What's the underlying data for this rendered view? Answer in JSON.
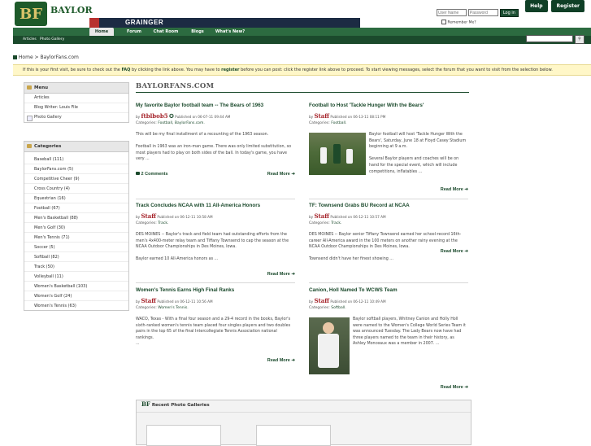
{
  "header": {
    "logo_letters": "BF",
    "logo_text": "BAYLOR",
    "banner_text": "GRAINGER",
    "buttons": [
      "Help",
      "Register"
    ],
    "login": {
      "username_placeholder": "User Name",
      "password_placeholder": "Password",
      "login_label": "Log in",
      "remember_label": "Remember Me?"
    }
  },
  "nav": {
    "tabs": [
      "Home",
      "Forum",
      "Chat Room",
      "Blogs",
      "What's New?"
    ],
    "sub": [
      "Articles",
      "Photo Gallery"
    ],
    "search_go": "⚲"
  },
  "breadcrumb": {
    "text": "Home > BaylorFans.com"
  },
  "notice": {
    "pre": "If this is your first visit, be sure to check out the ",
    "faq": "FAQ",
    "mid": " by clicking the link above. You may have to ",
    "register": "register",
    "post": " before you can post: click the register link above to proceed. To start viewing messages, select the forum that you want to visit from the selection below."
  },
  "menu": {
    "title": "Menu",
    "items": [
      "Articles",
      "Blog Writer: Louis File",
      "Photo Gallery"
    ]
  },
  "categories": {
    "title": "Categories",
    "items": [
      "Baseball (111)",
      "BaylorFans.com (5)",
      "Competitive Cheer (9)",
      "Cross Country (4)",
      "Equestrian (16)",
      "Football (67)",
      "Men's Basketball (88)",
      "Men's Golf (30)",
      "Men's Tennis (71)",
      "Soccer (5)",
      "Softball (82)",
      "Track (50)",
      "Volleyball (11)",
      "Women's Basketball (103)",
      "Women's Golf (24)",
      "Women's Tennis (63)"
    ]
  },
  "main": {
    "title": "BAYLORFANS.COM",
    "articles": [
      {
        "title": "My favorite Baylor football team -- The Bears of 1963",
        "author": "ftblbob5",
        "published": "Published on 06-07-11 09:44 AM",
        "categories_label": "Categories:",
        "categories": "Football, BaylorFans.com.",
        "body": "This will be my final installment of a recounting of the 1963 season.\n\nFootball in 1963 was an iron-man game. There was only limited substitution, so most players had to play on both sides of the ball. In today's game, you have very ...",
        "comments": "2 Comments",
        "more": "Read More ➜"
      },
      {
        "title": "Football to Host 'Tackle Hunger With the Bears'",
        "author": "Staff",
        "published": "Published on 06-13-11 08:11 PM",
        "categories_label": "Categories:",
        "categories": "Football.",
        "body": "Baylor football will host 'Tackle Hunger With the Bears', Saturday, June 18 at Floyd Casey Stadium beginning at 9 a.m.\n\nSeveral Baylor players and coaches will be on hand for the special event, which will include competitions, inflatables ...",
        "more": "Read More ➜"
      },
      {
        "title": "Track Concludes NCAA with 11 All-America Honors",
        "author": "Staff",
        "published": "Published on 06-12-11 10:58 AM",
        "categories_label": "Categories:",
        "categories": "Track.",
        "body": "DES MOINES -- Baylor's track and field team had outstanding efforts from the men's 4x400-meter relay team and Tiffany Townsend to cap the season at the NCAA Outdoor Championships in Des Moines, Iowa.\n\nBaylor earned 10 All-America honors as ...",
        "more": "Read More ➜"
      },
      {
        "title": "TF: Townsend Grabs BU Record at NCAA",
        "author": "Staff",
        "published": "Published on 06-12-11 10:57 AM",
        "categories_label": "Categories:",
        "categories": "Track.",
        "body": "DES MOINES -- Baylor senior Tiffany Townsend earned her school-record 16th-career All-America award in the 100 meters on another rainy evening at the NCAA Outdoor Championships in Des Moines, Iowa.\n\nTownsend didn't have her finest showing ...",
        "more": "Read More ➜"
      },
      {
        "title": "Women's Tennis Earns High Final Ranks",
        "author": "Staff",
        "published": "Published on 06-12-11 10:56 AM",
        "categories_label": "Categories:",
        "categories": "Women's Tennis.",
        "body": "WACO, Texas - With a final four season and a 29-4 record in the books, Baylor's sixth-ranked women's tennis team placed four singles players and two doubles pairs in the top 65 of the final Intercollegiate Tennis Association national rankings.\n...",
        "more": "Read More ➜"
      },
      {
        "title": "Canion, Holl Named To WCWS Team",
        "author": "Staff",
        "published": "Published on 06-12-11 10:49 AM",
        "categories_label": "Categories:",
        "categories": "Softball.",
        "body": "Baylor softball players, Whitney Canion and Holly Holl were named to the Women's College World Series Team it was announced Tuesday. The Lady Bears now have had three players named to the team in their history, as Ashley Monceaux was a member in 2007. ...",
        "more": "Read More ➜"
      }
    ]
  },
  "gallery": {
    "logo": "BF",
    "title": "Recent Photo Galleries"
  },
  "colors": {
    "brand_green": "#1b4a2c",
    "accent_gold": "#d9c36a",
    "author_red": "#a5232a"
  }
}
